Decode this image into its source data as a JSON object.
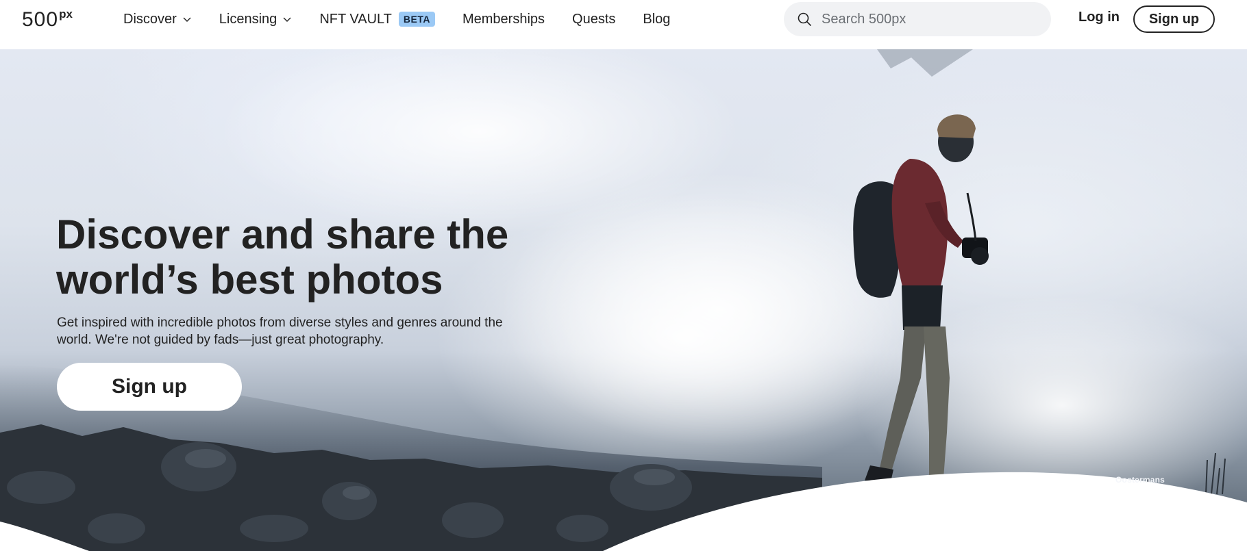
{
  "brand": {
    "logo_main": "500",
    "logo_sup": "px"
  },
  "nav": {
    "discover": "Discover",
    "licensing": "Licensing",
    "nft_vault": "NFT VAULT",
    "beta_badge": "BETA",
    "memberships": "Memberships",
    "quests": "Quests",
    "blog": "Blog"
  },
  "search": {
    "placeholder": "Search 500px",
    "value": ""
  },
  "auth": {
    "login": "Log in",
    "signup": "Sign up"
  },
  "hero": {
    "title_line1": "Discover and share the",
    "title_line2": "world’s best photos",
    "subtitle_line1": "Get inspired with incredible photos from diverse styles and genres around the",
    "subtitle_line2": "world. We're not guided by fads—just great photography.",
    "cta": "Sign up",
    "photo_credit": "Oostermans"
  },
  "icons": {
    "search": "search-icon",
    "discover_chevron": "chevron-down-icon",
    "licensing_chevron": "chevron-down-icon"
  },
  "colors": {
    "text": "#222222",
    "beta_badge_bg": "#9bc9f5",
    "search_bg": "#f1f2f4",
    "hero_fog": "#e3e8f2"
  }
}
